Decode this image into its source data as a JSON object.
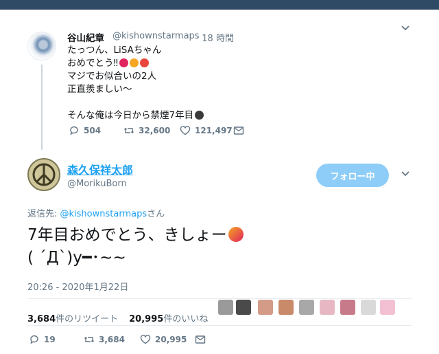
{
  "parent": {
    "name": "谷山紀章",
    "handle": "@kishownstarmaps",
    "time": "· 18 時間",
    "lines": [
      "たっつん、LiSAちゃん",
      "おめでとう‼",
      "マジでお似合いの2人",
      "正直羨ましい〜",
      "",
      "そんな俺は今日から禁煙7年目"
    ],
    "replies": "504",
    "retweets": "32,600",
    "likes": "121,497"
  },
  "main": {
    "name": "森久保祥太郎",
    "handle": "@MorikuBorn",
    "follow_label": "フォロー中",
    "reply_prefix": "返信先: ",
    "reply_handle": "@kishownstarmaps",
    "reply_suffix": "さん",
    "text_line1": "7年目おめでとう、きしょー",
    "text_line2": "( ´Д`)y━･~~",
    "timestamp": "20:26 - 2020年1月22日",
    "retweet_count": "3,684",
    "retweet_label": "件のリツイート",
    "like_count": "20,995",
    "like_label": "件のいいね",
    "replies": "19",
    "retweets": "3,684",
    "likes": "20,995"
  },
  "colors": {
    "accent": "#1da1f2",
    "follow_bg": "#8ecdf8",
    "background": "#2f4a64",
    "like": "#e0245e"
  },
  "icons": [
    "reply-icon",
    "retweet-icon",
    "like-icon",
    "message-icon",
    "chevron-down-icon"
  ]
}
